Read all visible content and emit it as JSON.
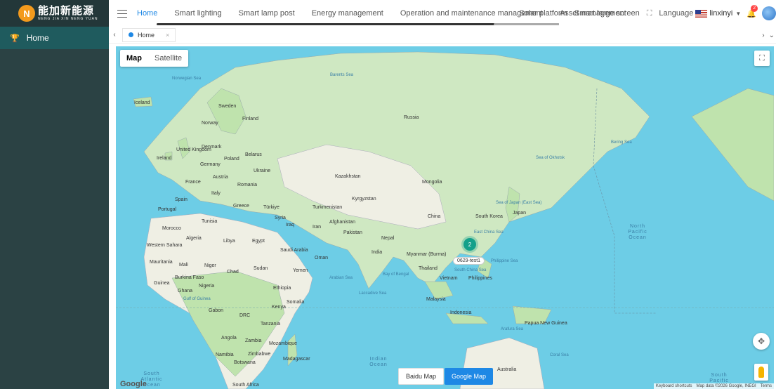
{
  "brand": {
    "logo_mark": "N",
    "name_cn": "能加新能源",
    "name_en": "NENG JIA XIN NENG YUAN"
  },
  "sidebar": {
    "items": [
      {
        "label": "Home",
        "icon": "trophy-icon"
      }
    ]
  },
  "nav": {
    "items": [
      "Home",
      "Smart lighting",
      "Smart lamp post",
      "Energy management",
      "Operation and maintenance management",
      "Asset management"
    ],
    "active": "Home"
  },
  "header": {
    "solar": "Solar platform",
    "large_screen": "Smart large screen",
    "language": "Language",
    "user": "linxinyi",
    "notif_count": "2"
  },
  "tabs": [
    {
      "label": "Home"
    }
  ],
  "map": {
    "type_map": "Map",
    "type_satellite": "Satellite",
    "cluster_count": "2",
    "marker_label": "0629-test1",
    "btn_baidu": "Baidu Map",
    "btn_google": "Google Map",
    "google_logo": "Google",
    "attrib_keyboard": "Keyboard shortcuts",
    "attrib_data": "Map data ©2026 Google, INEGI",
    "attrib_terms": "Terms",
    "countries": [
      "Iceland",
      "Sweden",
      "Norway",
      "Finland",
      "Russia",
      "United Kingdom",
      "Ireland",
      "Denmark",
      "Belarus",
      "Poland",
      "Germany",
      "Ukraine",
      "France",
      "Austria",
      "Romania",
      "Kazakhstan",
      "Mongolia",
      "Italy",
      "Spain",
      "Portugal",
      "Greece",
      "Türkiye",
      "Turkmenistan",
      "Kyrgyzstan",
      "China",
      "South Korea",
      "Japan",
      "Tunisia",
      "Morocco",
      "Syria",
      "Iraq",
      "Iran",
      "Afghanistan",
      "Pakistan",
      "Algeria",
      "Libya",
      "Egypt",
      "Nepal",
      "Western Sahara",
      "Saudi Arabia",
      "Oman",
      "India",
      "Myanmar (Burma)",
      "Mauritania",
      "Mali",
      "Niger",
      "Chad",
      "Sudan",
      "Yemen",
      "Thailand",
      "Vietnam",
      "Philippines",
      "Burkina Faso",
      "Guinea",
      "Ghana",
      "Nigeria",
      "Ethiopia",
      "Somalia",
      "Malaysia",
      "Gabon",
      "Kenya",
      "Indonesia",
      "DRC",
      "Tanzania",
      "Papua New Guinea",
      "Angola",
      "Zambia",
      "Mozambique",
      "Namibia",
      "Zimbabwe",
      "Madagascar",
      "Botswana",
      "Australia",
      "South Africa"
    ],
    "seas": [
      "Norwegian Sea",
      "Barents Sea",
      "Sea of Okhotsk",
      "Bering Sea",
      "Sea of Japan (East Sea)",
      "East China Sea",
      "Philippine Sea",
      "South China Sea",
      "Arabian Sea",
      "Bay of Bengal",
      "Laccadive Sea",
      "Gulf of Guinea",
      "Arafura Sea",
      "Coral Sea"
    ],
    "oceans": [
      "North Pacific Ocean",
      "Indian Ocean",
      "South Atlantic Ocean",
      "South Pacific"
    ]
  }
}
